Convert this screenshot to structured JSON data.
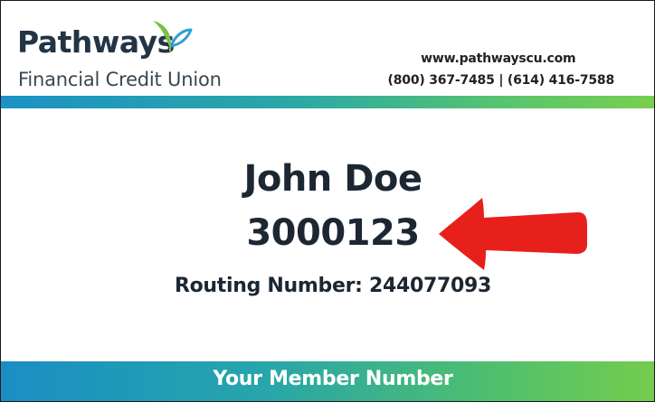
{
  "brand": {
    "name": "Pathways",
    "subtitle": "Financial Credit Union",
    "colors": {
      "navy": "#233445",
      "blue": "#1b92c4",
      "green": "#78cf4e",
      "arrow_red": "#e8201c"
    }
  },
  "contact": {
    "website": "www.pathwayscu.com",
    "phones": "(800) 367-7485  |  (614) 416-7588"
  },
  "member": {
    "name": "John Doe",
    "number": "3000123",
    "routing": "Routing Number: 244077093"
  },
  "footer": {
    "label": "Your Member Number"
  },
  "icons": {
    "logo_mark": "leaf-sprout-icon",
    "pointer": "red-arrow-left-icon"
  }
}
